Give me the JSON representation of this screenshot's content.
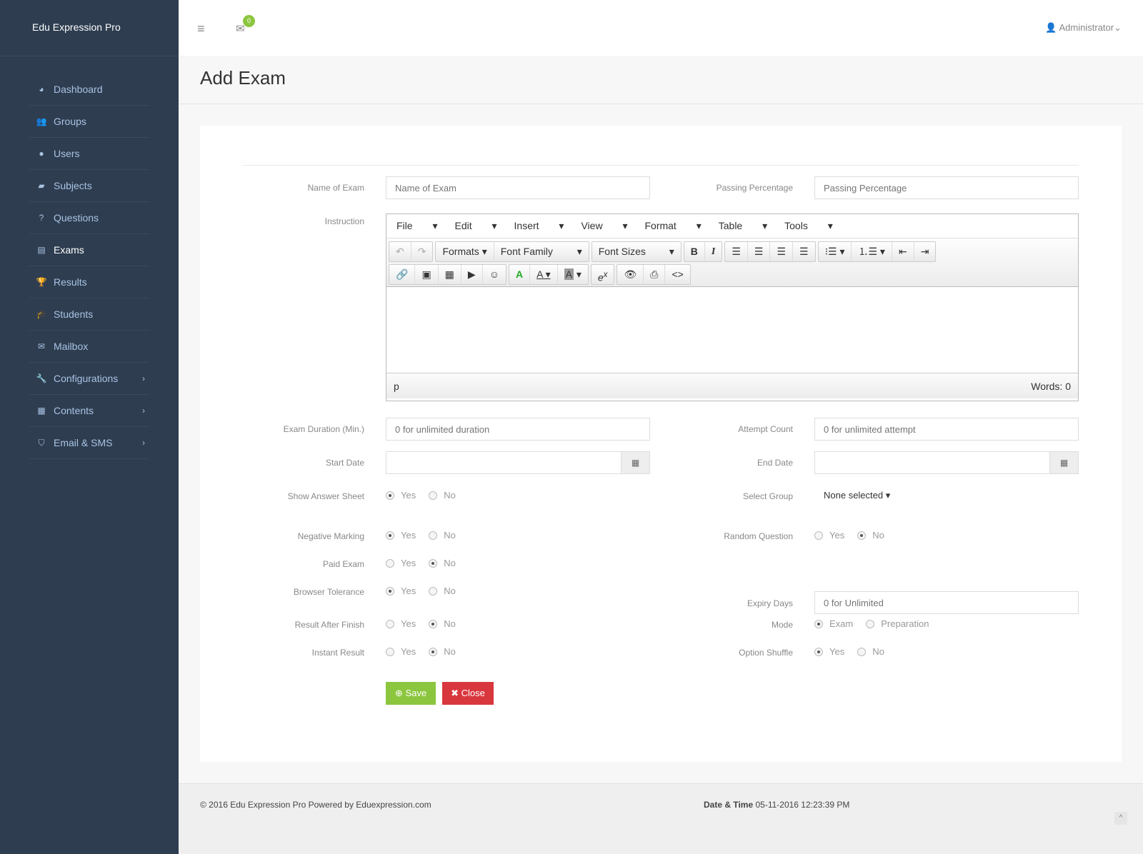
{
  "brand": "Edu Expression Pro",
  "sidebar": {
    "items": [
      {
        "label": "Dashboard",
        "icon": "dashboard-icon",
        "glyph": "◕"
      },
      {
        "label": "Groups",
        "icon": "users-icon",
        "glyph": "👥"
      },
      {
        "label": "Users",
        "icon": "user-icon",
        "glyph": "●"
      },
      {
        "label": "Subjects",
        "icon": "book-icon",
        "glyph": "▰"
      },
      {
        "label": "Questions",
        "icon": "question-icon",
        "glyph": "?"
      },
      {
        "label": "Exams",
        "icon": "list-icon",
        "glyph": "▤",
        "active": true
      },
      {
        "label": "Results",
        "icon": "trophy-icon",
        "glyph": "🏆"
      },
      {
        "label": "Students",
        "icon": "graduation-cap-icon",
        "glyph": "🎓"
      },
      {
        "label": "Mailbox",
        "icon": "envelope-icon",
        "glyph": "✉"
      },
      {
        "label": "Configurations",
        "icon": "wrench-icon",
        "glyph": "🔧",
        "chevron": "›"
      },
      {
        "label": "Contents",
        "icon": "newspaper-icon",
        "glyph": "▦",
        "chevron": "›"
      },
      {
        "label": "Email & SMS",
        "icon": "shield-icon",
        "glyph": "⛉",
        "chevron": "›"
      }
    ]
  },
  "header": {
    "mail_count": "0",
    "user": "Administrator"
  },
  "page_title": "Add Exam",
  "form": {
    "name_label": "Name of Exam",
    "name_placeholder": "Name of Exam",
    "pass_label": "Passing Percentage",
    "pass_placeholder": "Passing Percentage",
    "instruction_label": "Instruction",
    "editor": {
      "menus": [
        "File",
        "Edit",
        "Insert",
        "View",
        "Format",
        "Table",
        "Tools"
      ],
      "formats": "Formats",
      "font_family": "Font Family",
      "font_sizes": "Font Sizes",
      "path": "p",
      "words": "Words: 0"
    },
    "duration_label": "Exam Duration (Min.)",
    "duration_placeholder": "0 for unlimited duration",
    "attempt_label": "Attempt Count",
    "attempt_placeholder": "0 for unlimited attempt",
    "start_label": "Start Date",
    "end_label": "End Date",
    "select_group_label": "Select Group",
    "select_group_value": "None selected",
    "expiry_label": "Expiry Days",
    "expiry_placeholder": "0 for Unlimited",
    "radios": [
      {
        "label": "Show Answer Sheet",
        "side": "l",
        "opts": [
          "Yes",
          "No"
        ],
        "sel": 0
      },
      {
        "label": "Negative Marking",
        "side": "l",
        "opts": [
          "Yes",
          "No"
        ],
        "sel": 0
      },
      {
        "label": "Random Question",
        "side": "r",
        "opts": [
          "Yes",
          "No"
        ],
        "sel": 1
      },
      {
        "label": "Paid Exam",
        "side": "l",
        "opts": [
          "Yes",
          "No"
        ],
        "sel": 1
      },
      {
        "label": "Browser Tolerance",
        "side": "l",
        "opts": [
          "Yes",
          "No"
        ],
        "sel": 0
      },
      {
        "label": "Result After Finish",
        "side": "l",
        "opts": [
          "Yes",
          "No"
        ],
        "sel": 1
      },
      {
        "label": "Mode",
        "side": "r",
        "opts": [
          "Exam",
          "Preparation"
        ],
        "sel": 0
      },
      {
        "label": "Instant Result",
        "side": "l",
        "opts": [
          "Yes",
          "No"
        ],
        "sel": 1
      },
      {
        "label": "Option Shuffle",
        "side": "r",
        "opts": [
          "Yes",
          "No"
        ],
        "sel": 0
      }
    ],
    "save": "Save",
    "close": "Close"
  },
  "footer": {
    "copyright": "© 2016 Edu Expression Pro Powered by Eduexpression.com",
    "dt_label": "Date & Time",
    "dt_value": "05-11-2016 12:23:39 PM"
  }
}
